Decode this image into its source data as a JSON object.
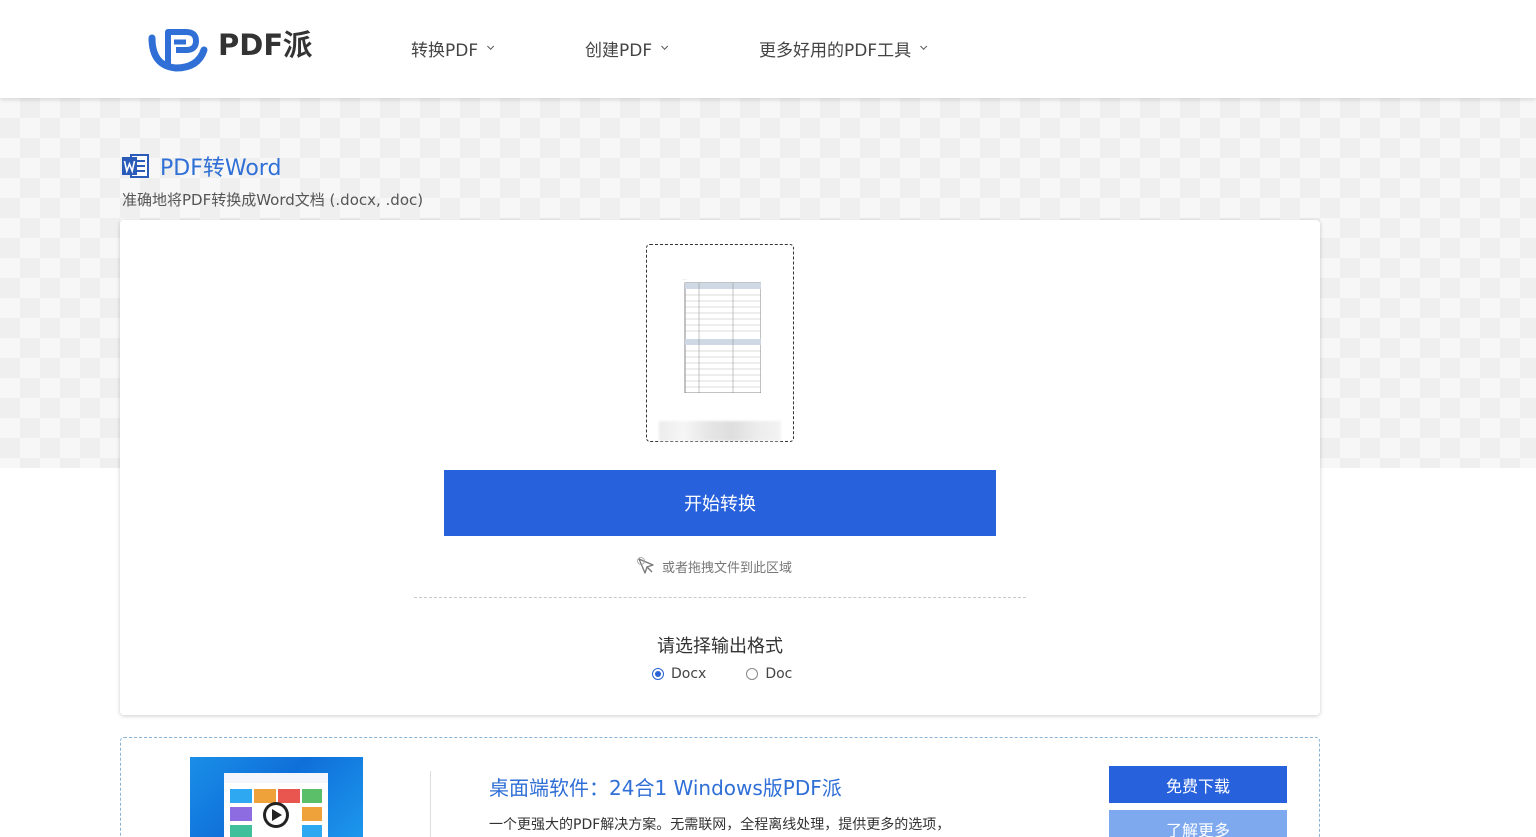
{
  "header": {
    "logo_text": "PDF派",
    "nav": [
      {
        "label": "转换PDF"
      },
      {
        "label": "创建PDF"
      },
      {
        "label": "更多好用的PDF工具"
      }
    ]
  },
  "page": {
    "title": "PDF转Word",
    "subtitle": "准确地将PDF转换成Word文档 (.docx, .doc)"
  },
  "converter": {
    "start_button": "开始转换",
    "drag_hint": "或者拖拽文件到此区域",
    "format_title": "请选择输出格式",
    "formats": [
      {
        "label": "Docx",
        "checked": true
      },
      {
        "label": "Doc",
        "checked": false
      }
    ]
  },
  "promo": {
    "title": "桌面端软件：24合1 Windows版PDF派",
    "description": "一个更强大的PDF解决方案。无需联网，全程离线处理，提供更多的选项，",
    "download_button": "免费下载",
    "learn_more_button": "了解更多"
  },
  "colors": {
    "accent": "#2761dc",
    "title_blue": "#2f6fd6",
    "secondary_button": "#7ea9ef"
  },
  "icons": {
    "logo": "pdfpai-logo-icon",
    "word": "word-doc-icon",
    "drag": "drag-pointer-icon",
    "chevron": "chevron-down-icon"
  }
}
